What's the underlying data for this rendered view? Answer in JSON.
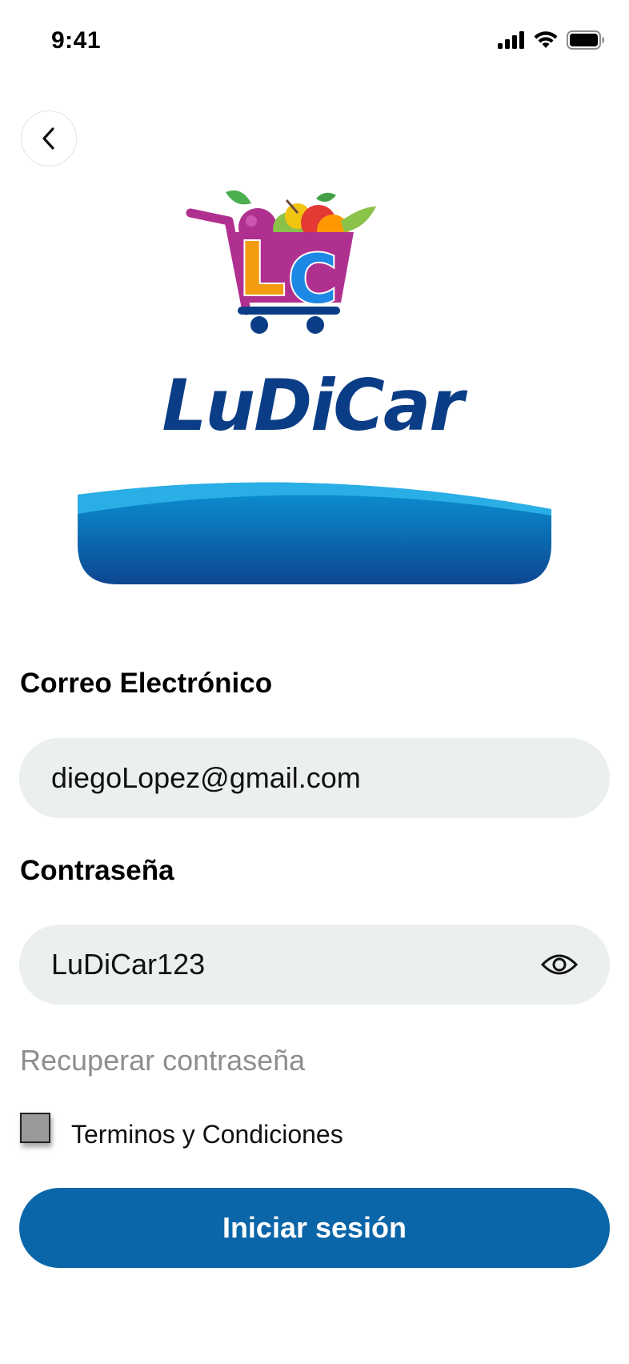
{
  "status_bar": {
    "time": "9:41"
  },
  "brand": {
    "name": "LuDiCar",
    "monogram": "LC",
    "colors": {
      "primary": "#0a66a8",
      "navy": "#0b3d86",
      "cart": "#b0308f",
      "orange": "#f39c12",
      "green": "#27ae60"
    }
  },
  "form": {
    "email": {
      "label": "Correo Electrónico",
      "value": "diegoLopez@gmail.com"
    },
    "password": {
      "label": "Contraseña",
      "value": "LuDiCar123"
    },
    "recover_link": "Recuperar contraseña",
    "terms": {
      "label": "Terminos y Condiciones",
      "checked": false
    },
    "submit_label": "Iniciar sesión"
  },
  "icons": {
    "back": "chevron-left-icon",
    "signal": "signal-icon",
    "wifi": "wifi-icon",
    "battery": "battery-icon",
    "password_toggle": "eye-icon"
  }
}
